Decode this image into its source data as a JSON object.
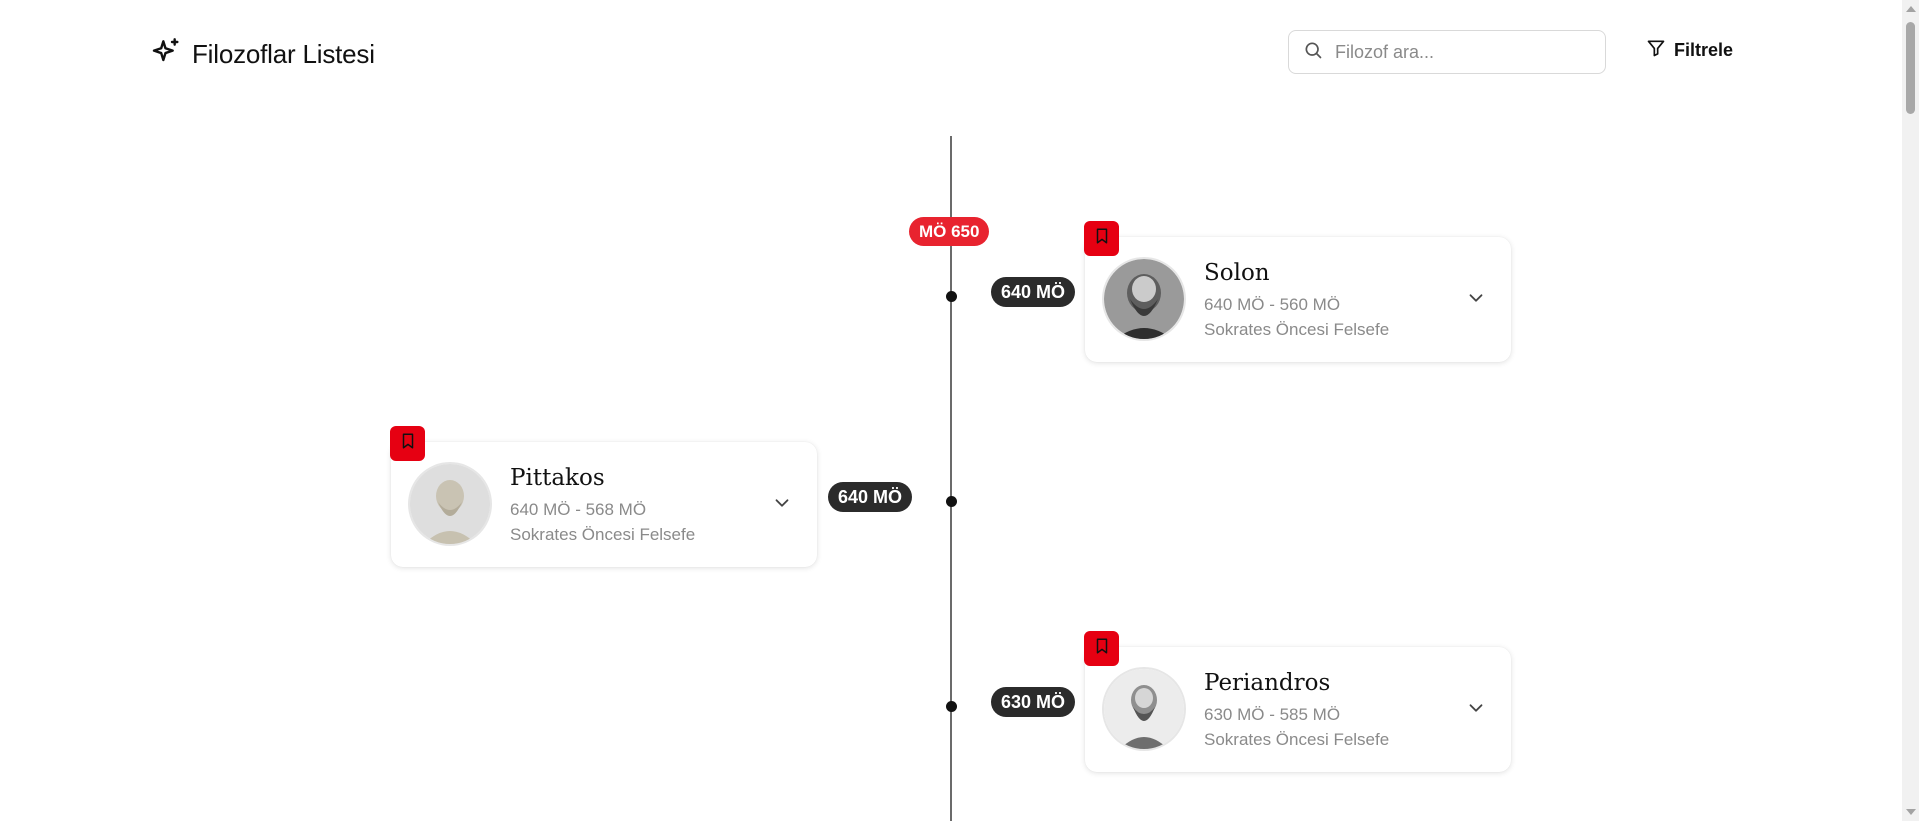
{
  "header": {
    "title": "Filozoflar Listesi",
    "search_placeholder": "Filozof ara...",
    "filter_label": "Filtrele"
  },
  "timeline": {
    "era_label": "MÖ 650",
    "entries": [
      {
        "year": "640 MÖ",
        "name": "Solon",
        "dates": "640 MÖ - 560 MÖ",
        "school": "Sokrates Öncesi Felsefe"
      },
      {
        "year": "640 MÖ",
        "name": "Pittakos",
        "dates": "640 MÖ - 568 MÖ",
        "school": "Sokrates Öncesi Felsefe"
      },
      {
        "year": "630 MÖ",
        "name": "Periandros",
        "dates": "630 MÖ - 585 MÖ",
        "school": "Sokrates Öncesi Felsefe"
      }
    ]
  },
  "colors": {
    "accent_red": "#e60012",
    "era_badge": "#e8232f",
    "year_pill": "#2b2b2b",
    "line": "#6b6b6b"
  },
  "icons": {
    "brand": "sparkles-icon",
    "search": "search-icon",
    "filter": "filter-icon",
    "bookmark": "bookmark-icon",
    "expand": "chevron-down-icon"
  }
}
